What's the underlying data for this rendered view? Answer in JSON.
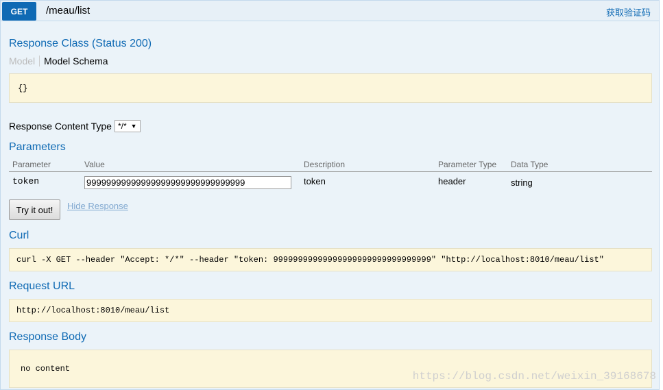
{
  "operation": {
    "method": "GET",
    "path": "/meau/list",
    "summary": "获取验证码"
  },
  "response_class": {
    "title": "Response Class (Status 200)",
    "tabs": [
      "Model",
      "Model Schema"
    ],
    "schema": "{}"
  },
  "response_content_type": {
    "label": "Response Content Type",
    "selected": "*/*"
  },
  "parameters": {
    "title": "Parameters",
    "columns": [
      "Parameter",
      "Value",
      "Description",
      "Parameter Type",
      "Data Type"
    ],
    "rows": [
      {
        "parameter": "token",
        "value": "99999999999999999999999999999999",
        "description": "token",
        "parameter_type": "header",
        "data_type": "string"
      }
    ]
  },
  "actions": {
    "try_label": "Try it out!",
    "hide_label": "Hide Response"
  },
  "curl": {
    "title": "Curl",
    "command": "curl -X GET --header \"Accept: */*\" --header \"token: 99999999999999999999999999999999\" \"http://localhost:8010/meau/list\""
  },
  "request_url": {
    "title": "Request URL",
    "url": "http://localhost:8010/meau/list"
  },
  "response_body": {
    "title": "Response Body",
    "content": "no content"
  },
  "watermark": "https://blog.csdn.net/weixin_39168678",
  "colors": {
    "accent": "#0f6ab4",
    "panel_bg": "#ebf3f9",
    "code_bg": "#fcf6db"
  }
}
